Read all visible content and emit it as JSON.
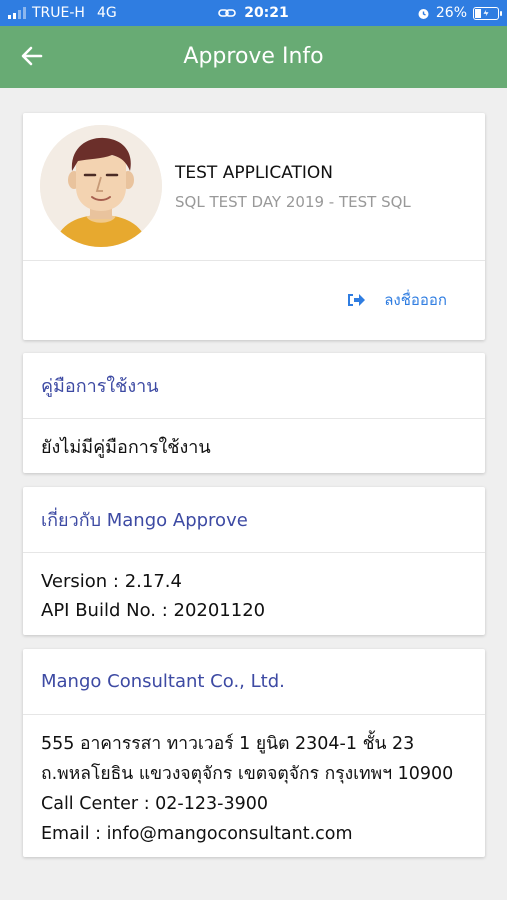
{
  "status_bar": {
    "carrier": "TRUE-H",
    "network": "4G",
    "time": "20:21",
    "battery": "26%"
  },
  "app_bar": {
    "title": "Approve Info"
  },
  "profile": {
    "app_name": "TEST APPLICATION",
    "subtitle": "SQL TEST  DAY 2019 - TEST SQL",
    "logout_label": "ลงชื่อออก"
  },
  "manual": {
    "header": "คู่มือการใช้งาน",
    "body": "ยังไม่มีคู่มือการใช้งาน"
  },
  "about": {
    "header": "เกี่ยวกับ Mango Approve",
    "version": "Version : 2.17.4",
    "api_build": "API Build No. : 20201120"
  },
  "company": {
    "header": "Mango Consultant Co., Ltd.",
    "address_line1": "555 อาคารรสา ทาวเวอร์ 1 ยูนิต 2304-1 ชั้น 23",
    "address_line2": "ถ.พหลโยธิน แขวงจตุจักร เขตจตุจักร กรุงเทพฯ 10900",
    "call_center": "Call Center : 02-123-3900",
    "email": "Email : info@mangoconsultant.com"
  },
  "colors": {
    "status_bar": "#2f7de1",
    "app_bar": "#68ab74",
    "section_header": "#3d4aa3",
    "link_blue": "#2f7de1"
  },
  "icons": [
    "signal-icon",
    "link-icon",
    "alarm-icon",
    "battery-icon",
    "back-arrow-icon",
    "avatar-icon",
    "logout-icon"
  ]
}
